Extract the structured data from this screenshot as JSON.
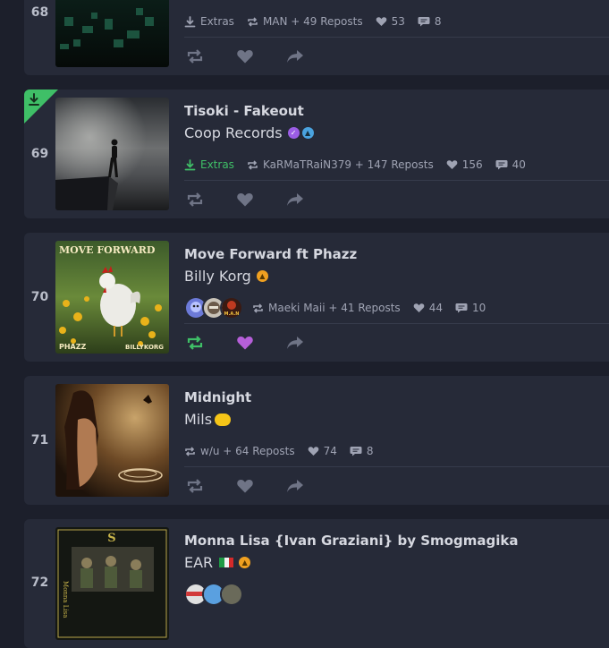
{
  "tracks": [
    {
      "rank": "68",
      "title": "",
      "artist": "",
      "extras": "Extras",
      "reposts": "MAN + 49 Reposts",
      "likes": "53",
      "comments": "8"
    },
    {
      "rank": "69",
      "title": "Tisoki - Fakeout",
      "artist": "Coop Records",
      "extras": "Extras",
      "reposts": "KaRMaTRaiN379 + 147 Reposts",
      "likes": "156",
      "comments": "40"
    },
    {
      "rank": "70",
      "title": "Move Forward ft Phazz",
      "artist": "Billy Korg",
      "cover_text_top": "MOVE FORWARD",
      "cover_text_left": "PHAZZ",
      "cover_text_right": "BILLYKORG",
      "avatar_tag": "M.A.N",
      "reposts": "Maeki Maii + 41 Reposts",
      "likes": "44",
      "comments": "10"
    },
    {
      "rank": "71",
      "title": "Midnight",
      "artist": "Mils",
      "reposts": "w/u + 64 Reposts",
      "likes": "74",
      "comments": "8"
    },
    {
      "rank": "72",
      "title": "Monna Lisa {Ivan Graziani} by Smogmagika",
      "artist": "EAR",
      "cover_text": "Monna Lisa",
      "reposts": "",
      "likes": "",
      "comments": ""
    }
  ],
  "colors": {
    "accent_green": "#3fbf67",
    "like_active": "#b65fd9",
    "verified": "#9b5de5",
    "badge_orange": "#f0a020",
    "badge_blue": "#4aa3df"
  }
}
